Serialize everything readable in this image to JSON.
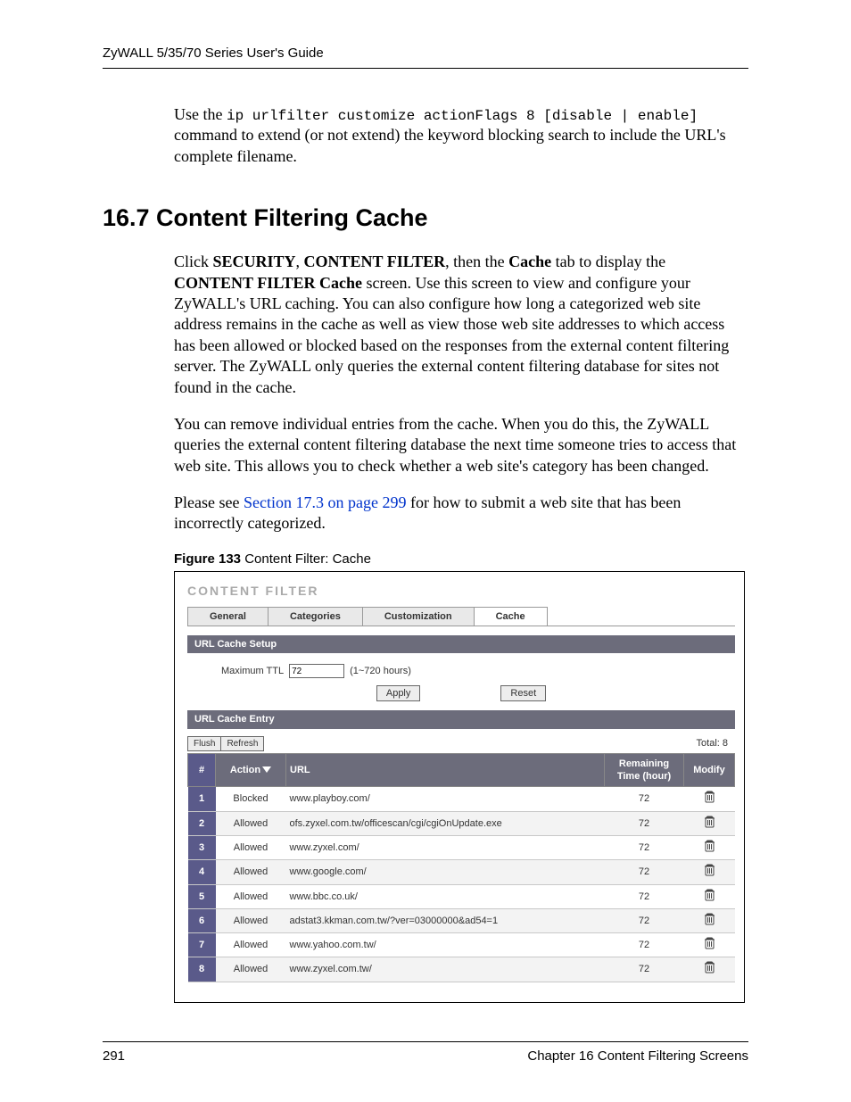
{
  "header": {
    "running_head": "ZyWALL 5/35/70 Series User's Guide"
  },
  "intro": {
    "use_the": "Use the ",
    "command_code": "ip urlfilter customize actionFlags 8 [disable | enable]",
    "command_after": " command to extend (or not extend) the keyword blocking search to include the URL's complete filename."
  },
  "section": {
    "number_title": "16.7  Content Filtering Cache",
    "p1_pre": "Click ",
    "p1_b1": "SECURITY",
    "p1_sep1": ", ",
    "p1_b2": "CONTENT FILTER",
    "p1_sep2": ", then the ",
    "p1_b3": "Cache",
    "p1_sep3": " tab to display the ",
    "p1_b4": "CONTENT FILTER Cache",
    "p1_post": " screen. Use this screen to view and configure your ZyWALL's URL caching. You can also configure how long a categorized web site address remains in the cache as well as view those web site addresses to which access has been allowed or blocked based on the responses from the external content filtering server. The ZyWALL only queries the external content filtering database for sites not found in the cache.",
    "p2": "You can remove individual entries from the cache. When you do this, the ZyWALL queries the external content filtering database the next time someone tries to access that web site. This allows you to check whether a web site's category has been changed.",
    "p3_pre": "Please see ",
    "p3_link": "Section 17.3 on page 299",
    "p3_post": " for how to submit a web site that has been incorrectly categorized."
  },
  "figure": {
    "label": "Figure 133",
    "title": "   Content Filter: Cache"
  },
  "shot": {
    "title": "CONTENT FILTER",
    "tabs": {
      "general": "General",
      "categories": "Categories",
      "customization": "Customization",
      "cache": "Cache"
    },
    "url_cache_setup": {
      "bar": "URL Cache Setup",
      "max_ttl_label": "Maximum TTL",
      "max_ttl_value": "72",
      "ttl_hint": "(1~720 hours)",
      "apply": "Apply",
      "reset": "Reset"
    },
    "url_cache_entry": {
      "bar": "URL Cache Entry",
      "flush": "Flush",
      "refresh": "Refresh",
      "total_label": "Total: 8",
      "headers": {
        "idx": "#",
        "action": "Action",
        "url": "URL",
        "remaining": "Remaining Time (hour)",
        "modify": "Modify"
      },
      "rows": [
        {
          "idx": "1",
          "action": "Blocked",
          "url": "www.playboy.com/",
          "remaining": "72"
        },
        {
          "idx": "2",
          "action": "Allowed",
          "url": "ofs.zyxel.com.tw/officescan/cgi/cgiOnUpdate.exe",
          "remaining": "72"
        },
        {
          "idx": "3",
          "action": "Allowed",
          "url": "www.zyxel.com/",
          "remaining": "72"
        },
        {
          "idx": "4",
          "action": "Allowed",
          "url": "www.google.com/",
          "remaining": "72"
        },
        {
          "idx": "5",
          "action": "Allowed",
          "url": "www.bbc.co.uk/",
          "remaining": "72"
        },
        {
          "idx": "6",
          "action": "Allowed",
          "url": "adstat3.kkman.com.tw/?ver=03000000&ad54=1",
          "remaining": "72"
        },
        {
          "idx": "7",
          "action": "Allowed",
          "url": "www.yahoo.com.tw/",
          "remaining": "72"
        },
        {
          "idx": "8",
          "action": "Allowed",
          "url": "www.zyxel.com.tw/",
          "remaining": "72"
        }
      ]
    }
  },
  "footer": {
    "page": "291",
    "chapter": "Chapter 16 Content Filtering Screens"
  }
}
